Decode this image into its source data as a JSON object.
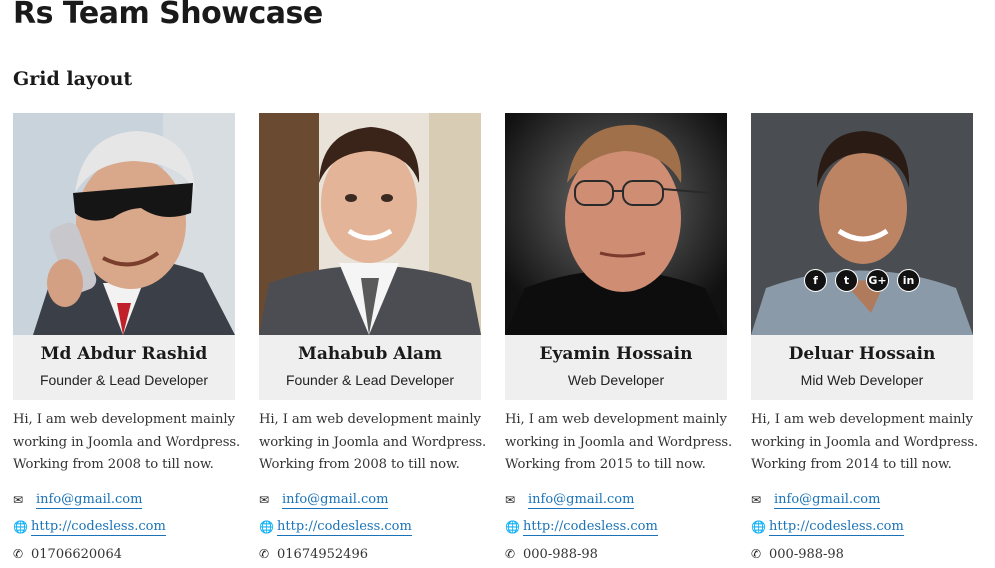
{
  "page_title": "Rs Team Showcase",
  "section_title": "Grid layout",
  "members": [
    {
      "name": "Md Abdur Rashid",
      "role": "Founder & Lead Developer",
      "bio": "Hi, I am web development mainly working in Joomla and Wordpress. Working from 2008 to till now.",
      "email": "info@gmail.com",
      "website": "http://codesless.com",
      "phone": "01706620064",
      "photo_icon": "person-on-phone-photo"
    },
    {
      "name": "Mahabub Alam",
      "role": "Founder & Lead Developer",
      "bio": "Hi, I am web development mainly working in Joomla and Wordpress. Working from 2008 to till now.",
      "email": "info@gmail.com",
      "website": "http://codesless.com",
      "phone": "01674952496",
      "photo_icon": "businessman-photo"
    },
    {
      "name": "Eyamin Hossain",
      "role": "Web Developer",
      "bio": "Hi, I am web development mainly working in Joomla and Wordpress. Working from 2015 to till now.",
      "email": "info@gmail.com",
      "website": "http://codesless.com",
      "phone": "000-988-98",
      "photo_icon": "man-with-glasses-photo"
    },
    {
      "name": "Deluar Hossain",
      "role": "Mid Web Developer",
      "bio": "Hi, I am web development mainly working in Joomla and Wordpress. Working from 2014 to till now.",
      "email": "info@gmail.com",
      "website": "http://codesless.com",
      "phone": "000-988-98",
      "photo_icon": "smiling-man-photo",
      "social": {
        "facebook": "f",
        "twitter": "t",
        "google_plus": "G+",
        "linkedin": "in"
      }
    }
  ],
  "icons": {
    "email": "envelope-icon",
    "website": "globe-icon",
    "phone": "phone-icon"
  },
  "colors": {
    "link": "#1a73b8",
    "info_box_bg": "#efefef",
    "social_bg": "#111111"
  }
}
